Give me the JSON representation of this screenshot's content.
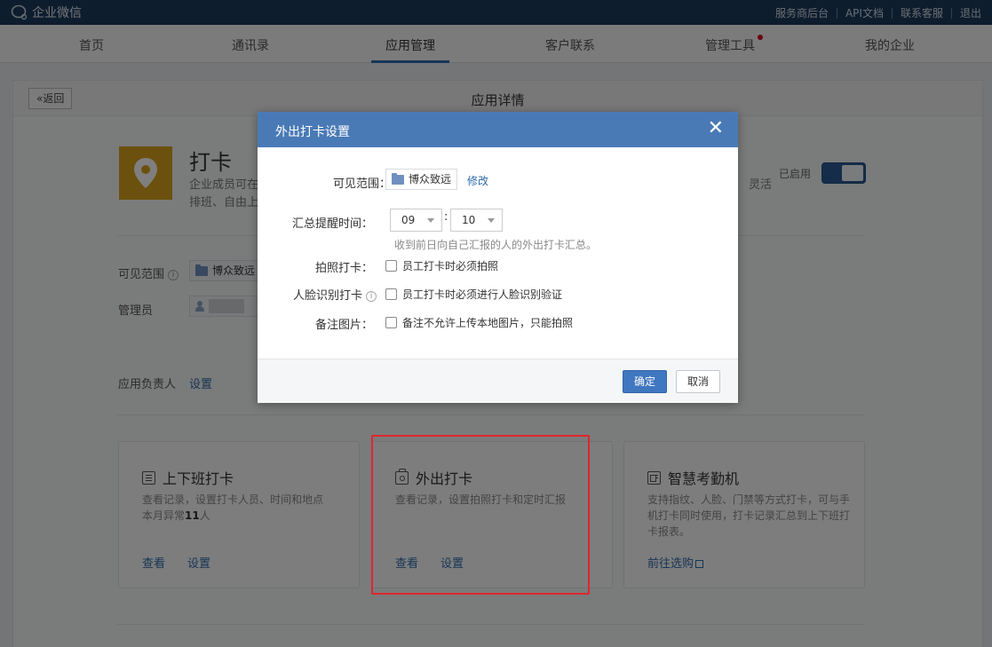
{
  "topbar": {
    "brand": "企业微信",
    "links": [
      "服务商后台",
      "API文档",
      "联系客服",
      "退出"
    ]
  },
  "nav": {
    "items": [
      "首页",
      "通讯录",
      "应用管理",
      "客户联系",
      "管理工具",
      "我的企业"
    ],
    "active": "应用管理"
  },
  "detail": {
    "back_label": "«返回",
    "title": "应用详情",
    "app_name": "打卡",
    "desc_line1": "企业成员可在",
    "desc_line2": "排班、自由上",
    "desc_right": "灵活",
    "enabled_label": "已启用",
    "visible_range_label": "可见范围",
    "visible_range_value": "博众致远",
    "admin_label": "管理员",
    "owner_label": "应用负责人",
    "owner_action": "设置"
  },
  "cards": [
    {
      "title": "上下班打卡",
      "desc": "查看记录，设置打卡人员、时间和地点",
      "desc2_prefix": "本月异常",
      "desc2_count": "11",
      "desc2_suffix": "人",
      "links": [
        "查看",
        "设置"
      ]
    },
    {
      "title": "外出打卡",
      "desc": "查看记录，设置拍照打卡和定时汇报",
      "links": [
        "查看",
        "设置"
      ]
    },
    {
      "title": "智慧考勤机",
      "desc": "支持指纹、人脸、门禁等方式打卡，可与手机打卡同时使用，打卡记录汇总到上下班打卡报表。",
      "link": "前往选购"
    }
  ],
  "dialog": {
    "title": "外出打卡设置",
    "close": "✕",
    "visible_range_label": "可见范围：",
    "visible_range_value": "博众致远",
    "modify": "修改",
    "summary_label": "汇总提醒时间：",
    "hour": "09",
    "minute": "10",
    "colon": ":",
    "summary_hint": "收到前日向自己汇报的人的外出打卡汇总。",
    "photo_label": "拍照打卡：",
    "photo_option": "员工打卡时必须拍照",
    "face_label": "人脸识别打卡",
    "face_option": "员工打卡时必须进行人脸识别验证",
    "note_label": "备注图片：",
    "note_option": "备注不允许上传本地图片，只能拍照",
    "confirm": "确定",
    "cancel": "取消"
  },
  "colors": {
    "topbar": "#1b3a5d",
    "dialog_header": "#4a7ab6",
    "primary": "#3f77c0",
    "app_icon": "#d9a11c",
    "highlight": "#e0262b"
  }
}
